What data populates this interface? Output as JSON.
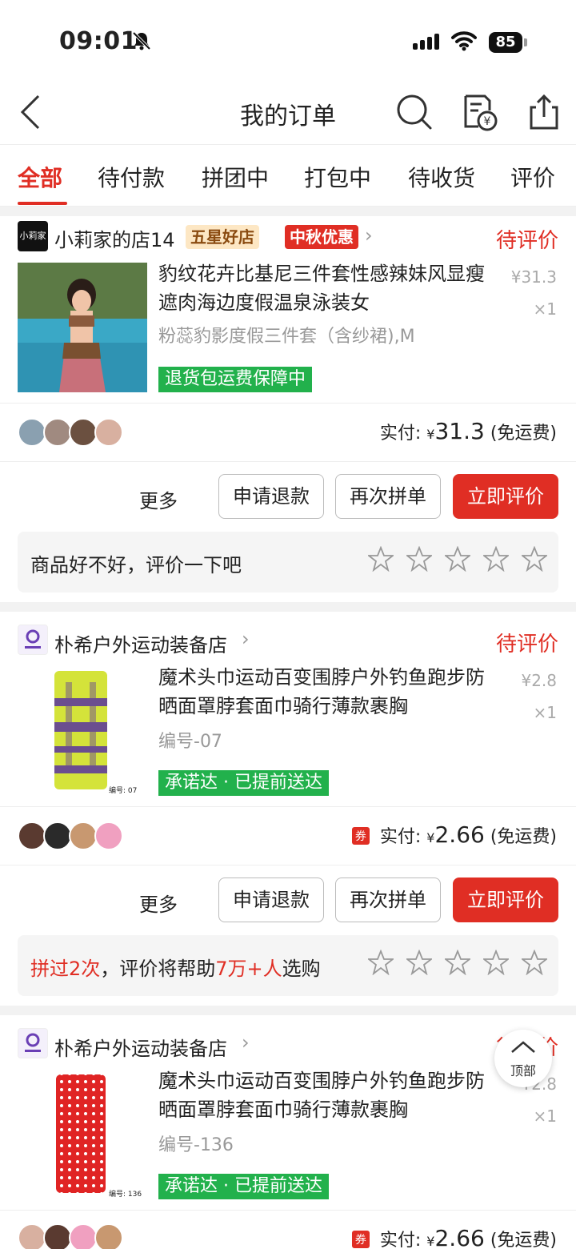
{
  "status_bar": {
    "time": "09:01",
    "battery": "85"
  },
  "nav": {
    "title": "我的订单"
  },
  "tabs": [
    "全部",
    "待付款",
    "拼团中",
    "打包中",
    "待收货",
    "评价"
  ],
  "orders": [
    {
      "shop": "小莉家的店14",
      "shop_logo_text": "小莉家",
      "badge_five_star": "五星好店",
      "badge_promo": "中秋优惠",
      "status": "待评价",
      "title": "豹纹花卉比基尼三件套性感辣妹风显瘦遮肉海边度假温泉泳装女",
      "spec": "粉蕊豹影度假三件套（含纱裙),M",
      "price": "¥31.3",
      "qty": "×1",
      "service": "退货包运费保障中",
      "paid_label": "实付:",
      "paid_yen": "¥",
      "paid_amount": "31.3",
      "shipping": "(免运费)",
      "more": "更多",
      "btn_refund": "申请退款",
      "btn_rebuy": "再次拼单",
      "btn_review": "立即评价",
      "review_prompt": "商品好不好，评价一下吧"
    },
    {
      "shop": "朴希户外运动装备店",
      "status": "待评价",
      "title": "魔术头巾运动百变围脖户外钓鱼跑步防晒面罩脖套面巾骑行薄款裹胸",
      "spec": "编号-07",
      "image_caption": "编号: 07",
      "price": "¥2.8",
      "qty": "×1",
      "service": "承诺达 · 已提前送达",
      "coupon": "券",
      "paid_label": "实付:",
      "paid_yen": "¥",
      "paid_amount": "2.66",
      "shipping": "(免运费)",
      "more": "更多",
      "btn_refund": "申请退款",
      "btn_rebuy": "再次拼单",
      "btn_review": "立即评价",
      "review_prompt_a": "拼过",
      "review_prompt_b": "2次",
      "review_prompt_c": "，评价将帮助",
      "review_prompt_d": "7万+人",
      "review_prompt_e": "选购"
    },
    {
      "shop": "朴希户外运动装备店",
      "status": "待评价",
      "title": "魔术头巾运动百变围脖户外钓鱼跑步防晒面罩脖套面巾骑行薄款裹胸",
      "spec": "编号-136",
      "image_caption": "编号: 136",
      "price": "¥2.8",
      "qty": "×1",
      "service": "承诺达 · 已提前送达",
      "coupon": "券",
      "paid_label": "实付:",
      "paid_yen": "¥",
      "paid_amount": "2.66",
      "shipping": "(免运费)"
    }
  ],
  "back_to_top": "顶部",
  "colors": {
    "accent": "#e02e24",
    "green": "#22b14c"
  }
}
